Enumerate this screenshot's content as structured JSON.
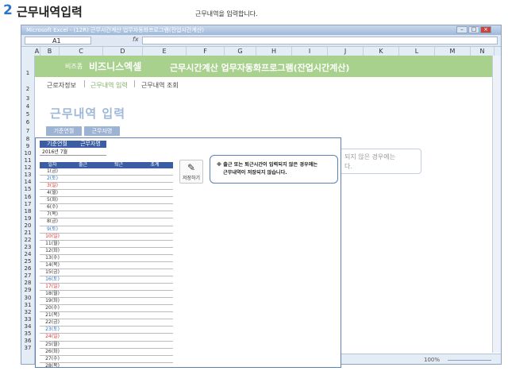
{
  "header": {
    "number": "2",
    "title": "근무내역입력",
    "subtitle": "근무내역을 입력합니다."
  },
  "excel": {
    "window_title": "Microsoft Excel - (12R) 근무시간계산 업무자동화프로그램(잔업시간계산)",
    "name_box": "A1",
    "fx": "fx",
    "columns": [
      "A",
      "B",
      "C",
      "D",
      "E",
      "F",
      "G",
      "H",
      "I",
      "J",
      "K",
      "L",
      "M",
      "N"
    ],
    "rows": [
      "1",
      "2",
      "3",
      "4",
      "5",
      "6",
      "7",
      "8",
      "9",
      "10",
      "11",
      "12",
      "13",
      "14",
      "15",
      "16",
      "17",
      "18",
      "19",
      "20",
      "21",
      "22",
      "23",
      "24",
      "25",
      "26",
      "27",
      "28",
      "29",
      "30",
      "31",
      "32",
      "33",
      "34",
      "35",
      "36",
      "37",
      "38",
      "39"
    ],
    "zoom": "100%"
  },
  "banner": {
    "brand_small": "비즈폼",
    "brand": "비즈니스엑셀",
    "program_title": "근무시간계산 업무자동화프로그램(잔업시간계산)"
  },
  "tabs": {
    "items": [
      "근로자정보",
      "근무내역 입력",
      "근무내역 조회"
    ],
    "separator": "|"
  },
  "page": {
    "big_title": "근무내역 입력",
    "btn_period": "기준연월",
    "btn_worker": "근무자명",
    "bg_note": "되지 않은 경우에는\n다."
  },
  "popup": {
    "label_period": "기준연월",
    "label_worker": "근무자명",
    "period_value": "2016년 7월",
    "columns": [
      "일자",
      "출근",
      "퇴근",
      "초계"
    ],
    "days": [
      {
        "d": "1(금)",
        "t": "w"
      },
      {
        "d": "2(토)",
        "t": "sat"
      },
      {
        "d": "3(일)",
        "t": "sun"
      },
      {
        "d": "4(월)",
        "t": "w"
      },
      {
        "d": "5(화)",
        "t": "w"
      },
      {
        "d": "6(수)",
        "t": "w"
      },
      {
        "d": "7(목)",
        "t": "w"
      },
      {
        "d": "8(금)",
        "t": "w"
      },
      {
        "d": "9(토)",
        "t": "sat"
      },
      {
        "d": "10(일)",
        "t": "sun"
      },
      {
        "d": "11(월)",
        "t": "w"
      },
      {
        "d": "12(화)",
        "t": "w"
      },
      {
        "d": "13(수)",
        "t": "w"
      },
      {
        "d": "14(목)",
        "t": "w"
      },
      {
        "d": "15(금)",
        "t": "w"
      },
      {
        "d": "16(토)",
        "t": "sat"
      },
      {
        "d": "17(일)",
        "t": "sun"
      },
      {
        "d": "18(월)",
        "t": "w"
      },
      {
        "d": "19(화)",
        "t": "w"
      },
      {
        "d": "20(수)",
        "t": "w"
      },
      {
        "d": "21(목)",
        "t": "w"
      },
      {
        "d": "22(금)",
        "t": "w"
      },
      {
        "d": "23(토)",
        "t": "sat"
      },
      {
        "d": "24(일)",
        "t": "sun"
      },
      {
        "d": "25(월)",
        "t": "w"
      },
      {
        "d": "26(화)",
        "t": "w"
      },
      {
        "d": "27(수)",
        "t": "w"
      },
      {
        "d": "28(목)",
        "t": "w"
      }
    ],
    "save_label": "저장하기",
    "notice_line1": "※ 출근 또는 퇴근시간이 입력되지 않은 경우에는",
    "notice_line2": "근무내역이 저장되지 않습니다.",
    "colors": {
      "header_fill": "#3a5da3",
      "saturday": "#2e74c7",
      "sunday": "#d33333"
    }
  }
}
